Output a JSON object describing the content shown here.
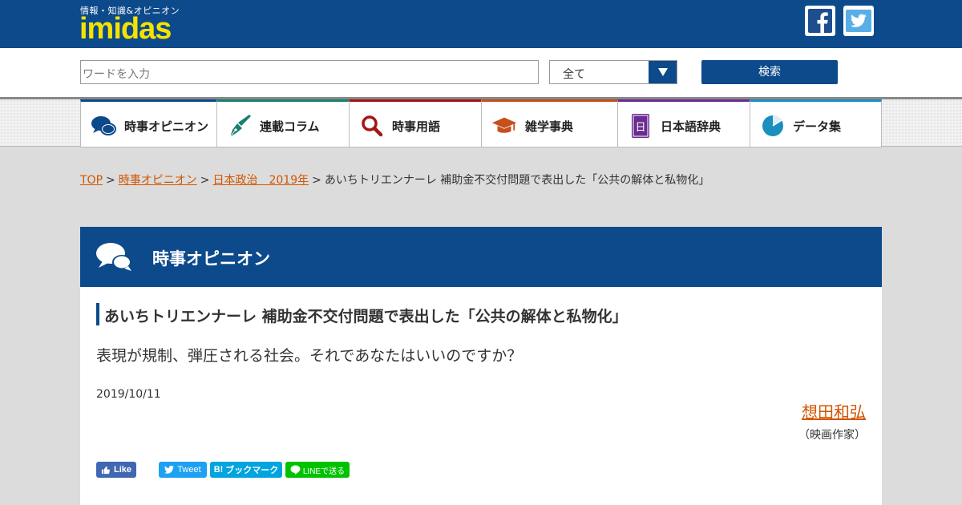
{
  "header": {
    "tagline": "情報・知識&オピニオン",
    "logo": "imidas",
    "brand_color": "#0c4a8b",
    "logo_color": "#f6e200",
    "social": [
      "facebook-icon",
      "twitter-icon"
    ]
  },
  "search": {
    "placeholder": "ワードを入力",
    "scope_selected": "全て",
    "button_label": "検索"
  },
  "nav": {
    "items": [
      {
        "label": "時事オピニオン",
        "icon": "speech-bubbles-icon",
        "color": "#0c4a8b"
      },
      {
        "label": "連載コラム",
        "icon": "fountain-pen-icon",
        "color": "#1a7f6e"
      },
      {
        "label": "時事用語",
        "icon": "magnifier-icon",
        "color": "#a31515"
      },
      {
        "label": "雑学事典",
        "icon": "graduation-cap-icon",
        "color": "#c4501a"
      },
      {
        "label": "日本語辞典",
        "icon": "dictionary-icon",
        "color": "#6a2c91"
      },
      {
        "label": "データ集",
        "icon": "pie-chart-icon",
        "color": "#1a8fc0"
      }
    ]
  },
  "breadcrumb": {
    "items": [
      "TOP",
      "時事オピニオン",
      "日本政治　2019年"
    ],
    "current": "あいちトリエンナーレ 補助金不交付問題で表出した「公共の解体と私物化」"
  },
  "section": {
    "title": "時事オピニオン"
  },
  "article": {
    "title": "あいちトリエンナーレ 補助金不交付問題で表出した「公共の解体と私物化」",
    "lead": "表現が規制、弾圧される社会。それであなたはいいのですか？",
    "date": "2019/10/11",
    "author": "想田和弘",
    "author_role": "（映画作家）"
  },
  "share": {
    "like": "Like",
    "tweet": "Tweet",
    "hatena": "ブックマーク",
    "hatena_prefix": "B!",
    "line": "LINEで送る"
  }
}
